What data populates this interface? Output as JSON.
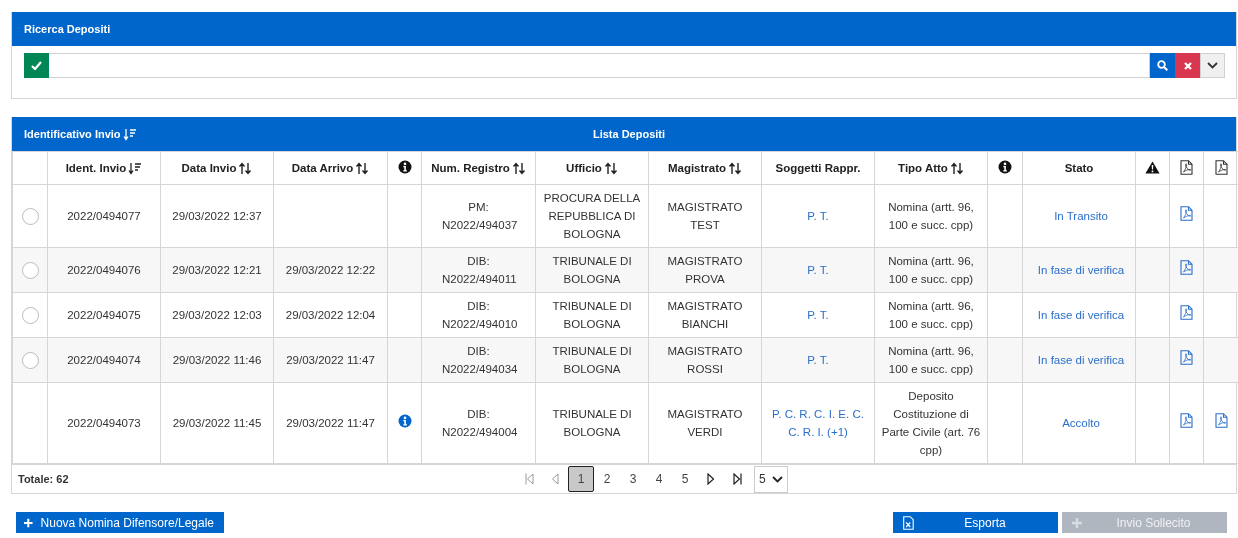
{
  "search_panel": {
    "title": "Ricerca Depositi",
    "apply_button": {
      "selected": true
    }
  },
  "list_panel": {
    "sort_label": "Identificativo Invio",
    "title": "Lista Depositi",
    "columns": [
      {
        "kind": "select"
      },
      {
        "kind": "text",
        "label": "Ident. Invio",
        "sortable": true,
        "sorted_descending": true
      },
      {
        "kind": "text",
        "label": "Data Invio",
        "sortable": true,
        "sorted_descending": false
      },
      {
        "kind": "text",
        "label": "Data Arrivo",
        "sortable": true,
        "sorted_descending": false
      },
      {
        "kind": "info"
      },
      {
        "kind": "text",
        "label": "Num. Registro",
        "sortable": true,
        "sorted_descending": false
      },
      {
        "kind": "text",
        "label": "Ufficio",
        "sortable": true,
        "sorted_descending": false
      },
      {
        "kind": "text",
        "label": "Magistrato",
        "sortable": true,
        "sorted_descending": false
      },
      {
        "kind": "text",
        "label": "Soggetti Rappr.",
        "sortable": false
      },
      {
        "kind": "text",
        "label": "Tipo Atto",
        "sortable": true,
        "sorted_descending": false
      },
      {
        "kind": "info"
      },
      {
        "kind": "text",
        "label": "Stato",
        "sortable": false
      },
      {
        "kind": "warning"
      },
      {
        "kind": "document"
      },
      {
        "kind": "document"
      }
    ],
    "rows": [
      {
        "kind": "selectable",
        "selected": false,
        "id": "2022/0494077",
        "sent": "29/03/2022 12:37",
        "info": false,
        "register": "PM: N2022/494037",
        "office": "PROCURA DELLA REPUBBLICA DI BOLOGNA",
        "magistrate": "MAGISTRATO TEST",
        "subjects": "P. T.",
        "act_type": "Nomina (artt. 96, 100 e succ. cpp)",
        "status": "In Transito",
        "document": true,
        "second_document": false
      },
      {
        "kind": "selectable",
        "selected": false,
        "id": "2022/0494076",
        "sent": "29/03/2022 12:21",
        "arrived": "29/03/2022 12:22",
        "info": false,
        "register": "DIB: N2022/494011",
        "office": "TRIBUNALE DI BOLOGNA",
        "magistrate": "MAGISTRATO PROVA",
        "subjects": "P. T.",
        "act_type": "Nomina (artt. 96, 100 e succ. cpp)",
        "status": "In fase di verifica",
        "document": true,
        "second_document": false
      },
      {
        "kind": "selectable",
        "selected": false,
        "id": "2022/0494075",
        "sent": "29/03/2022 12:03",
        "arrived": "29/03/2022 12:04",
        "info": false,
        "register": "DIB: N2022/494010",
        "office": "TRIBUNALE DI BOLOGNA",
        "magistrate": "MAGISTRATO BIANCHI",
        "subjects": "P. T.",
        "act_type": "Nomina (artt. 96, 100 e succ. cpp)",
        "status": "In fase di verifica",
        "document": true,
        "second_document": false
      },
      {
        "kind": "selectable",
        "selected": false,
        "id": "2022/0494074",
        "sent": "29/03/2022 11:46",
        "arrived": "29/03/2022 11:47",
        "info": false,
        "register": "DIB: N2022/494034",
        "office": "TRIBUNALE DI BOLOGNA",
        "magistrate": "MAGISTRATO ROSSI",
        "subjects": "P. T.",
        "act_type": "Nomina (artt. 96, 100 e succ. cpp)",
        "status": "In fase di verifica",
        "document": true,
        "second_document": false
      },
      {
        "kind": "plain",
        "id": "2022/0494073",
        "sent": "29/03/2022 11:45",
        "arrived": "29/03/2022 11:47",
        "info": true,
        "register": "DIB: N2022/494004",
        "office": "TRIBUNALE DI BOLOGNA",
        "magistrate": "MAGISTRATO VERDI",
        "subjects": "P. C. R. C. I. E. C. C. R. I. (+1)",
        "act_type": "Deposito Costituzione di Parte Civile (art. 76 cpp)",
        "status": "Accolto",
        "document": true,
        "second_document": true
      }
    ],
    "total": "Totale: 62",
    "pagination": {
      "pages": [
        {
          "label": "1",
          "selected": true
        },
        {
          "label": "2",
          "selected": false
        },
        {
          "label": "3",
          "selected": false
        },
        {
          "label": "4",
          "selected": false
        },
        {
          "label": "5",
          "selected": false
        }
      ],
      "page_size": "5"
    }
  },
  "buttons": [
    {
      "kind": "add",
      "label": "Nuova Nomina Difensore/Legale",
      "disabled": false
    },
    {
      "kind": "export",
      "label": "Esporta",
      "disabled": false
    },
    {
      "kind": "add",
      "label": "Invio Sollecito",
      "disabled": true
    }
  ]
}
